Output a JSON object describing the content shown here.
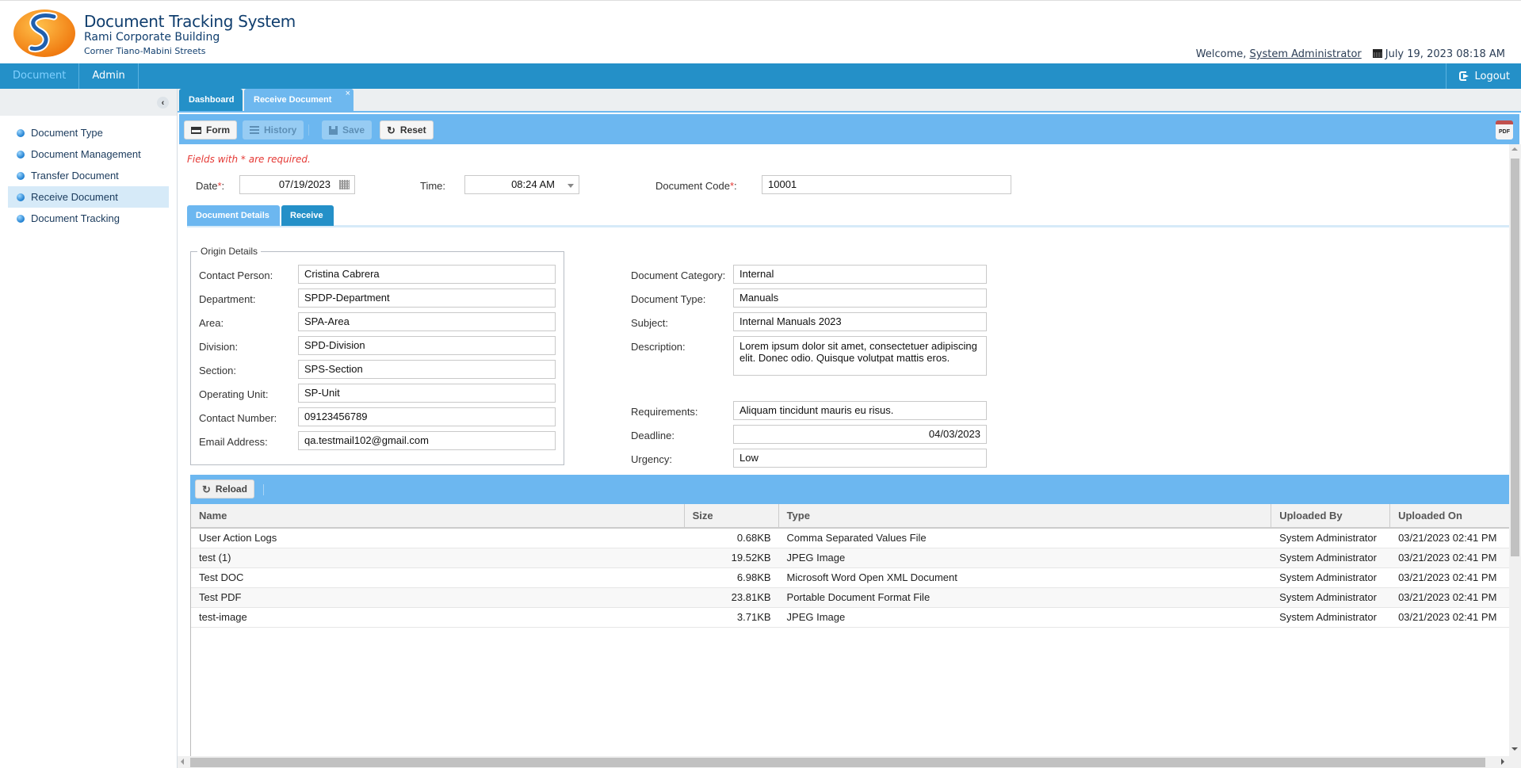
{
  "header": {
    "title": "Document Tracking System",
    "subtitle": "Rami Corporate Building",
    "address": "Corner Tiano-Mabini Streets",
    "welcome_prefix": "Welcome,",
    "user_name": "System Administrator",
    "datetime": "July 19, 2023 08:18 AM"
  },
  "nav": {
    "items": [
      {
        "label": "Document",
        "active": true
      },
      {
        "label": "Admin",
        "active": false
      }
    ],
    "logout_label": "Logout"
  },
  "sidebar": {
    "items": [
      {
        "label": "Document Type",
        "active": false
      },
      {
        "label": "Document Management",
        "active": false
      },
      {
        "label": "Transfer Document",
        "active": false
      },
      {
        "label": "Receive Document",
        "active": true
      },
      {
        "label": "Document Tracking",
        "active": false
      }
    ]
  },
  "tabs": {
    "dashboard": "Dashboard",
    "receive_document": "Receive Document",
    "close_glyph": "×"
  },
  "toolbar": {
    "form": "Form",
    "history": "History",
    "save": "Save",
    "reset": "Reset",
    "pdf": "PDF"
  },
  "form": {
    "required_note": "Fields with * are required.",
    "date_label": "Date",
    "date_value": "07/19/2023",
    "time_label": "Time:",
    "time_value": "08:24 AM",
    "doc_code_label": "Document Code",
    "doc_code_value": "10001",
    "required_star": "*",
    "colon": ":"
  },
  "subtabs": {
    "details": "Document Details",
    "receive": "Receive"
  },
  "origin": {
    "legend": "Origin Details",
    "fields": [
      {
        "label": "Contact Person:",
        "value": "Cristina Cabrera"
      },
      {
        "label": "Department:",
        "value": "SPDP-Department"
      },
      {
        "label": "Area:",
        "value": "SPA-Area"
      },
      {
        "label": "Division:",
        "value": "SPD-Division"
      },
      {
        "label": "Section:",
        "value": "SPS-Section"
      },
      {
        "label": "Operating Unit:",
        "value": "SP-Unit"
      },
      {
        "label": "Contact Number:",
        "value": "09123456789"
      },
      {
        "label": "Email Address:",
        "value": "qa.testmail102@gmail.com"
      }
    ]
  },
  "document": {
    "category_label": "Document Category:",
    "category_value": "Internal",
    "type_label": "Document Type:",
    "type_value": "Manuals",
    "subject_label": "Subject:",
    "subject_value": "Internal Manuals 2023",
    "description_label": "Description:",
    "description_value": "Lorem ipsum dolor sit amet, consectetuer adipiscing elit. Donec odio. Quisque volutpat mattis eros.",
    "requirements_label": "Requirements:",
    "requirements_value": "Aliquam tincidunt mauris eu risus.",
    "deadline_label": "Deadline:",
    "deadline_value": "04/03/2023",
    "urgency_label": "Urgency:",
    "urgency_value": "Low"
  },
  "attachments": {
    "reload_label": "Reload",
    "columns": [
      "Name",
      "Size",
      "Type",
      "Uploaded By",
      "Uploaded On"
    ],
    "rows": [
      {
        "name": "User Action Logs",
        "size": "0.68KB",
        "type": "Comma Separated Values File",
        "uploaded_by": "System Administrator",
        "uploaded_on": "03/21/2023 02:41 PM"
      },
      {
        "name": "test (1)",
        "size": "19.52KB",
        "type": "JPEG Image",
        "uploaded_by": "System Administrator",
        "uploaded_on": "03/21/2023 02:41 PM"
      },
      {
        "name": "Test DOC",
        "size": "6.98KB",
        "type": "Microsoft Word Open XML Document",
        "uploaded_by": "System Administrator",
        "uploaded_on": "03/21/2023 02:41 PM"
      },
      {
        "name": "Test PDF",
        "size": "23.81KB",
        "type": "Portable Document Format File",
        "uploaded_by": "System Administrator",
        "uploaded_on": "03/21/2023 02:41 PM"
      },
      {
        "name": "test-image",
        "size": "3.71KB",
        "type": "JPEG Image",
        "uploaded_by": "System Administrator",
        "uploaded_on": "03/21/2023 02:41 PM"
      }
    ]
  },
  "colors": {
    "nav_blue": "#2490c8",
    "toolbar_blue": "#6cb7f0",
    "required_red": "#e53935",
    "sidebar_active": "#d6eaf8",
    "brand_text": "#103e6e"
  }
}
